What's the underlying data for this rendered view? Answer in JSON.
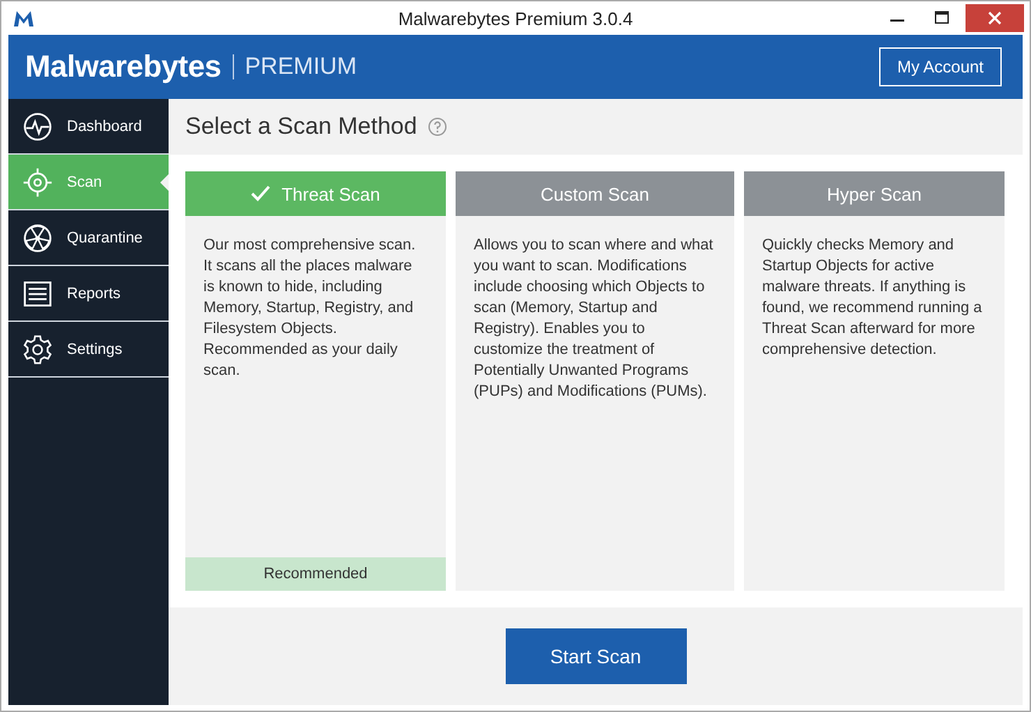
{
  "window": {
    "title": "Malwarebytes Premium 3.0.4"
  },
  "header": {
    "brand": "Malwarebytes",
    "edition": "PREMIUM",
    "account_button": "My Account"
  },
  "sidebar": {
    "items": [
      {
        "label": "Dashboard",
        "kind": "dashboard",
        "selected": false
      },
      {
        "label": "Scan",
        "kind": "scan",
        "selected": true
      },
      {
        "label": "Quarantine",
        "kind": "quarantine",
        "selected": false
      },
      {
        "label": "Reports",
        "kind": "reports",
        "selected": false
      },
      {
        "label": "Settings",
        "kind": "settings",
        "selected": false
      }
    ]
  },
  "page_title": "Select a Scan Method",
  "scan_methods": [
    {
      "title": "Threat Scan",
      "selected": true,
      "description": "Our most comprehensive scan. It scans all the places malware is known to hide, including Memory, Startup, Registry, and Filesystem Objects. Recommended as your daily scan.",
      "badge": "Recommended"
    },
    {
      "title": "Custom Scan",
      "selected": false,
      "description": "Allows you to scan where and what you want to scan. Modifications include choosing which Objects to scan (Memory, Startup and Registry). Enables you to customize the treatment of Potentially Unwanted Programs (PUPs) and Modifications (PUMs)."
    },
    {
      "title": "Hyper Scan",
      "selected": false,
      "description": "Quickly checks Memory and Startup Objects for active malware threats. If anything is found, we recommend running a Threat Scan afterward for more comprehensive detection."
    }
  ],
  "start_button": "Start Scan"
}
